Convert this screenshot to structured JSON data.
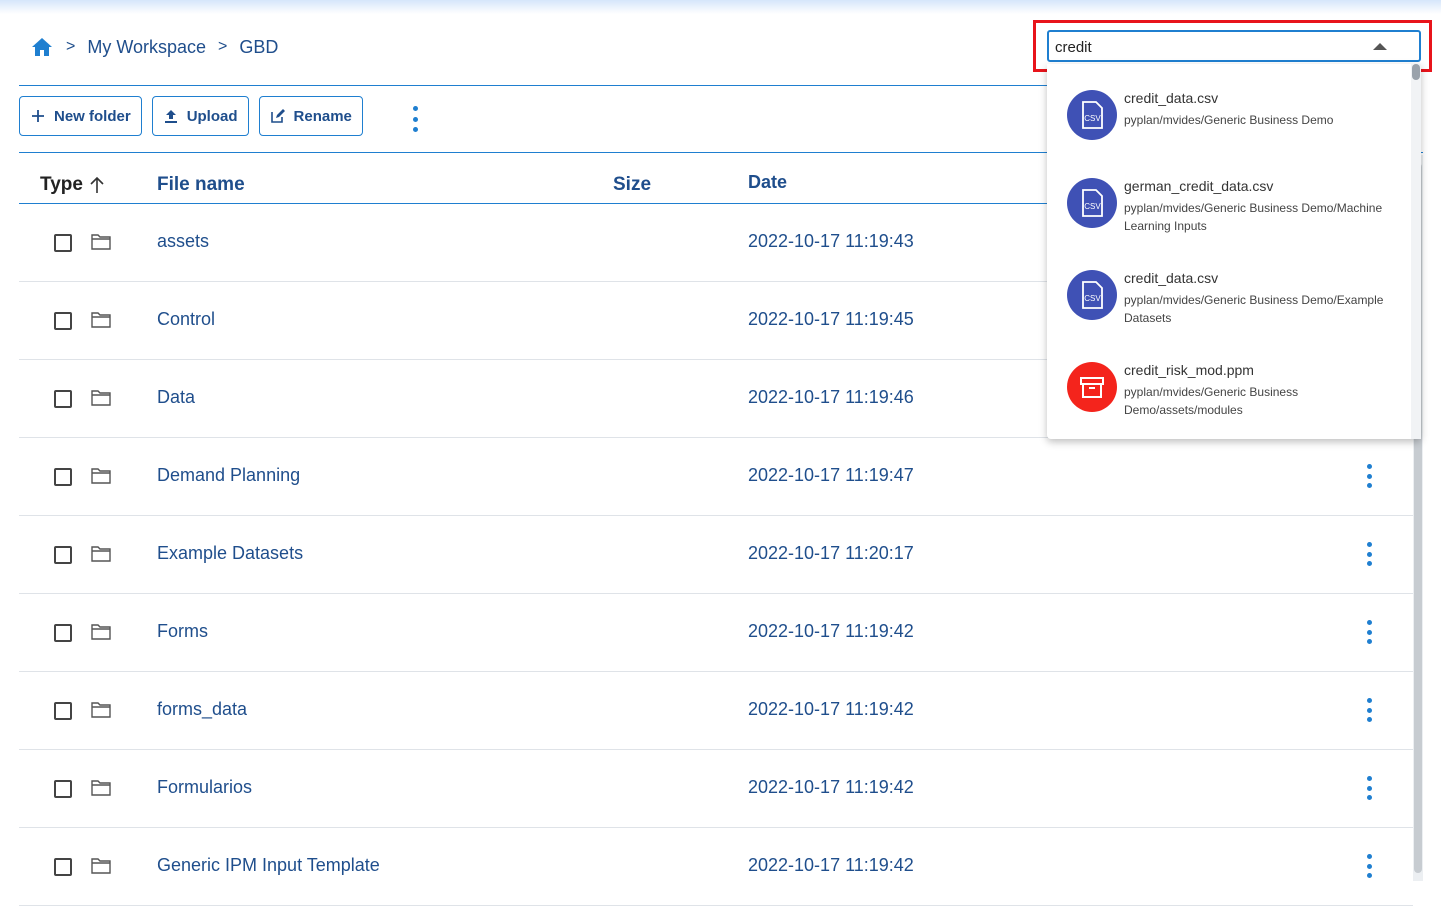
{
  "breadcrumb": {
    "items": [
      "My Workspace",
      "GBD"
    ],
    "separator": ">"
  },
  "toolbar": {
    "new_folder_label": "New folder",
    "upload_label": "Upload",
    "rename_label": "Rename"
  },
  "table": {
    "headers": {
      "type": "Type",
      "name": "File name",
      "size": "Size",
      "date": "Date"
    },
    "rows": [
      {
        "name": "assets",
        "date": "2022-10-17 11:19:43"
      },
      {
        "name": "Control",
        "date": "2022-10-17 11:19:45"
      },
      {
        "name": "Data",
        "date": "2022-10-17 11:19:46"
      },
      {
        "name": "Demand Planning",
        "date": "2022-10-17 11:19:47"
      },
      {
        "name": "Example Datasets",
        "date": "2022-10-17 11:20:17"
      },
      {
        "name": "Forms",
        "date": "2022-10-17 11:19:42"
      },
      {
        "name": "forms_data",
        "date": "2022-10-17 11:19:42"
      },
      {
        "name": "Formularios",
        "date": "2022-10-17 11:19:42"
      },
      {
        "name": "Generic IPM Input Template",
        "date": "2022-10-17 11:19:42"
      }
    ]
  },
  "search": {
    "value": "credit",
    "results": [
      {
        "name": "credit_data.csv",
        "path": "pyplan/mvides/Generic Business Demo",
        "icon": "csv-file-icon",
        "color": "#3f51b5"
      },
      {
        "name": "german_credit_data.csv",
        "path": "pyplan/mvides/Generic Business Demo/Machine Learning Inputs",
        "icon": "csv-file-icon",
        "color": "#3f51b5"
      },
      {
        "name": "credit_data.csv",
        "path": "pyplan/mvides/Generic Business Demo/Example Datasets",
        "icon": "csv-file-icon",
        "color": "#3f51b5"
      },
      {
        "name": "credit_risk_mod.ppm",
        "path": "pyplan/mvides/Generic Business Demo/assets/modules",
        "icon": "archive-icon",
        "color": "#f4241c"
      }
    ]
  },
  "colors": {
    "accent": "#1f7fd0",
    "text": "#1f4e8c",
    "highlight": "#e8141b"
  }
}
